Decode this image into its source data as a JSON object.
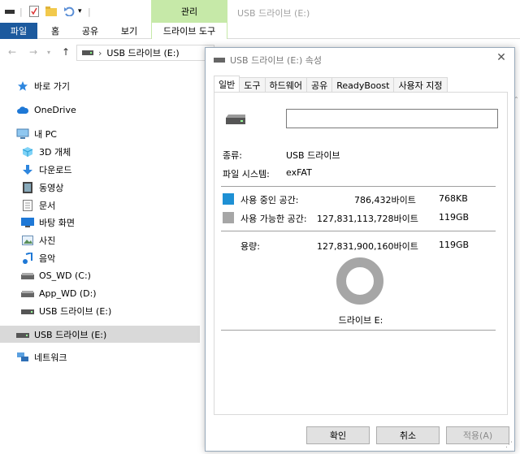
{
  "titlebar": {
    "manage_tab": "관리",
    "window_title": "USB 드라이브 (E:)"
  },
  "ribbon": {
    "tabs": [
      "파일",
      "홈",
      "공유",
      "보기",
      "드라이브 도구"
    ]
  },
  "address": {
    "path": "USB 드라이브 (E:)"
  },
  "navpane": {
    "items": [
      {
        "label": "바로 가기",
        "icon": "star-icon"
      },
      {
        "label": "OneDrive",
        "icon": "cloud-icon"
      },
      {
        "label": "내 PC",
        "icon": "computer-icon"
      },
      {
        "label": "3D 개체",
        "icon": "cube-icon"
      },
      {
        "label": "다운로드",
        "icon": "download-icon"
      },
      {
        "label": "동영상",
        "icon": "video-icon"
      },
      {
        "label": "문서",
        "icon": "document-icon"
      },
      {
        "label": "바탕 화면",
        "icon": "desktop-icon"
      },
      {
        "label": "사진",
        "icon": "picture-icon"
      },
      {
        "label": "음악",
        "icon": "music-icon"
      },
      {
        "label": "OS_WD (C:)",
        "icon": "drive-icon"
      },
      {
        "label": "App_WD (D:)",
        "icon": "drive-icon"
      },
      {
        "label": "USB 드라이브 (E:)",
        "icon": "usb-drive-icon"
      },
      {
        "label": "USB 드라이브 (E:)",
        "icon": "usb-drive-icon"
      },
      {
        "label": "네트워크",
        "icon": "network-icon"
      }
    ]
  },
  "dialog": {
    "title": "USB 드라이브 (E:) 속성",
    "tabs": [
      "일반",
      "도구",
      "하드웨어",
      "공유",
      "ReadyBoost",
      "사용자 지정"
    ],
    "name_value": "",
    "type_label": "종류:",
    "type_value": "USB 드라이브",
    "fs_label": "파일 시스템:",
    "fs_value": "exFAT",
    "used_label": "사용 중인 공간:",
    "used_bytes": "786,432바이트",
    "used_size": "768KB",
    "free_label": "사용 가능한 공간:",
    "free_bytes": "127,831,113,728바이트",
    "free_size": "119GB",
    "capacity_label": "용량:",
    "capacity_bytes": "127,831,900,160바이트",
    "capacity_size": "119GB",
    "used_fraction": 6.2e-06,
    "drive_label": "드라이브 E:",
    "ok": "확인",
    "cancel": "취소",
    "apply": "적용(A)"
  },
  "colors": {
    "used": "#1e90d4",
    "free": "#a6a6a6",
    "file_tab": "#1c5a9e",
    "manage_tab": "#c6e9a8",
    "selected_nav": "#d9d9d9"
  }
}
